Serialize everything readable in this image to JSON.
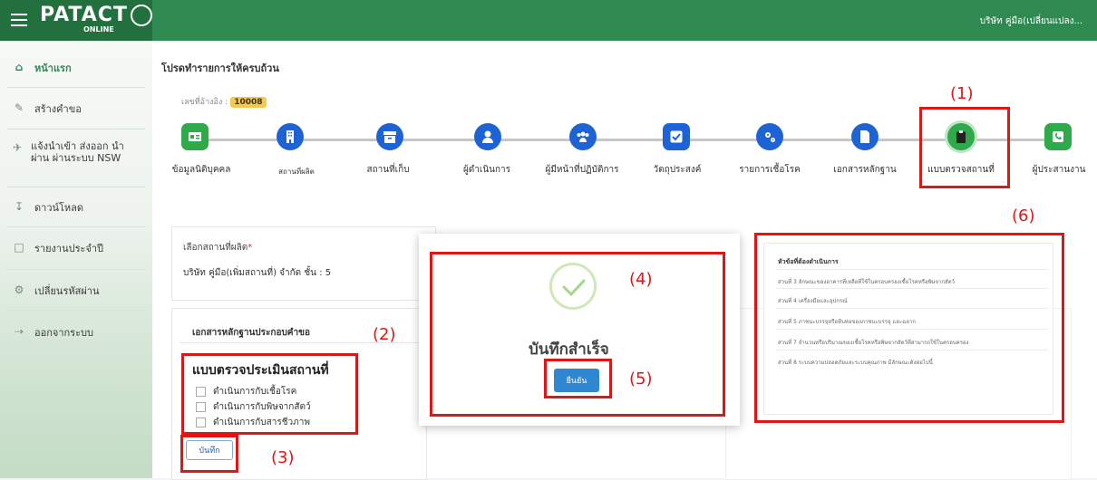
{
  "header": {
    "logo_text": "PATACT",
    "logo_sub": "ONLINE",
    "user_name": "บริษัท คู่มือ(เปลี่ยนแปลง..."
  },
  "sidebar": {
    "items": [
      {
        "label": "หน้าแรก",
        "icon": "home-icon"
      },
      {
        "label": "สร้างคำขอ",
        "icon": "pencil-icon"
      },
      {
        "label": "แจ้งนำเข้า ส่งออก นำผ่าน ผ่านระบบ NSW",
        "icon": "plane-icon"
      },
      {
        "label": "ดาวน์โหลด",
        "icon": "download-icon"
      },
      {
        "label": "รายงานประจำปี",
        "icon": "file-icon"
      },
      {
        "label": "เปลี่ยนรหัสผ่าน",
        "icon": "gears-icon"
      },
      {
        "label": "ออกจากระบบ",
        "icon": "sign-out-icon"
      }
    ]
  },
  "main": {
    "title": "โปรดทำรายการให้ครบถ้วน",
    "ref_label": "เลขที่อ้างอิง :",
    "ref_value": "10008"
  },
  "steps": [
    {
      "label": "ข้อมูลนิติบุคคล",
      "color": "#2eaa4b",
      "icon": "id-card-icon"
    },
    {
      "label": "สถานที่ผลิต",
      "color": "#1e63d6",
      "icon": "building-icon"
    },
    {
      "label": "สถานที่เก็บ",
      "color": "#1e63d6",
      "icon": "archive-icon"
    },
    {
      "label": "ผู้ดำเนินการ",
      "color": "#1e63d6",
      "icon": "user-icon"
    },
    {
      "label": "ผู้มีหน้าที่ปฏิบัติการ",
      "color": "#1e63d6",
      "icon": "users-icon"
    },
    {
      "label": "วัตถุประสงค์",
      "color": "#1e63d6",
      "icon": "check-square-icon"
    },
    {
      "label": "รายการเชื้อโรค",
      "color": "#1e63d6",
      "icon": "cogs-icon"
    },
    {
      "label": "เอกสารหลักฐาน",
      "color": "#1e63d6",
      "icon": "file-icon"
    },
    {
      "label": "แบบตรวจสถานที่",
      "color": "#2eaa4b",
      "icon": "clipboard-icon"
    },
    {
      "label": "ผู้ประสานงาน",
      "color": "#2eaa4b",
      "icon": "phone-icon"
    }
  ],
  "form": {
    "select_label": "เลือกสถานที่ผลิต",
    "required_mark": "*",
    "select_value": "บริษัท คู่มือ(เพิ่มสถานที่) จำกัด ชั้น : 5",
    "docs_title": "เอกสารหลักฐานประกอบคำขอ",
    "section_title": "แบบตรวจประเมินสถานที่",
    "checkboxes": [
      "ดำเนินการกับเชื้อโรค",
      "ดำเนินการกับพิษจากสัตว์",
      "ดำเนินการกับสารชีวภาพ"
    ],
    "save_label": "บันทึก"
  },
  "right_card": {
    "heading": "หัวข้อที่ต้องดำเนินการ",
    "items": [
      "ส่วนที่ 3 ลักษณะของอาคารที่เหลือที่ใช้ในครอบครองเชื้อโรคหรือพิษจากสัตว์",
      "ส่วนที่ 4 เครื่องมือและอุปกรณ์",
      "ส่วนที่ 5 ภาชนะบรรจุหรือหีบห่อของภาชนะบรรจุ และฉลาก",
      "ส่วนที่ 7 จำนวนหรือปริมาณของเชื้อโรคหรือพิษจากสัตว์ที่สามารถใช้ในครอบครอง",
      "ส่วนที่ 8 ระบบความปลอดภัยและระบบคุณภาพ มีลักษณะดังต่อไปนี้"
    ]
  },
  "modal": {
    "title": "บันทึกสำเร็จ",
    "confirm_label": "ยืนยัน"
  },
  "annotations": [
    "(1)",
    "(2)",
    "(3)",
    "(4)",
    "(5)",
    "(6)"
  ],
  "colors": {
    "annotation": "#e01515",
    "header": "#2f8a52",
    "step_blue": "#1e63d6",
    "step_green": "#2eaa4b"
  }
}
